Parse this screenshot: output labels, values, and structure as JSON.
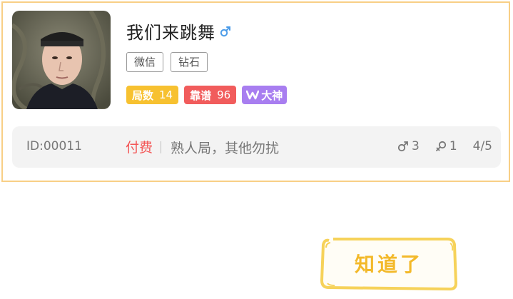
{
  "user": {
    "name": "我们来跳舞",
    "gender_icon": "male-icon",
    "tags": [
      "微信",
      "钻石"
    ],
    "badges": {
      "rounds_label": "局数",
      "rounds_value": "14",
      "reputation_label": "靠谱",
      "reputation_value": "96",
      "master_label": "大神"
    }
  },
  "room": {
    "id": "ID:00011",
    "fee_type": "付费",
    "note": "熟人局，其他勿扰",
    "male_count": "3",
    "female_count": "1",
    "occupancy": "4/5"
  },
  "actions": {
    "ok_label": "知道了"
  },
  "colors": {
    "card_border": "#f8cf86",
    "male_blue": "#4a9be8",
    "rounds_badge": "#f7c130",
    "reputation_badge": "#f15c5c",
    "master_badge": "#a87ef0",
    "fee_red": "#f35656",
    "button_yellow": "#f3b92a"
  }
}
